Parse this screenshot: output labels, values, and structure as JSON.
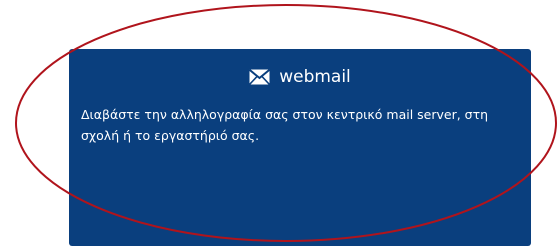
{
  "colors": {
    "card_background": "#0a3f7e",
    "text": "#ffffff",
    "annotation_ellipse": "#b0141c"
  },
  "webmail_card": {
    "icon": "envelope-icon",
    "title": "webmail",
    "description": "Διαβάστε την αλληλογραφία σας στον κεντρικό mail server, στη σχολή ή το εργαστήριό σας."
  },
  "annotation": {
    "shape": "ellipse"
  }
}
